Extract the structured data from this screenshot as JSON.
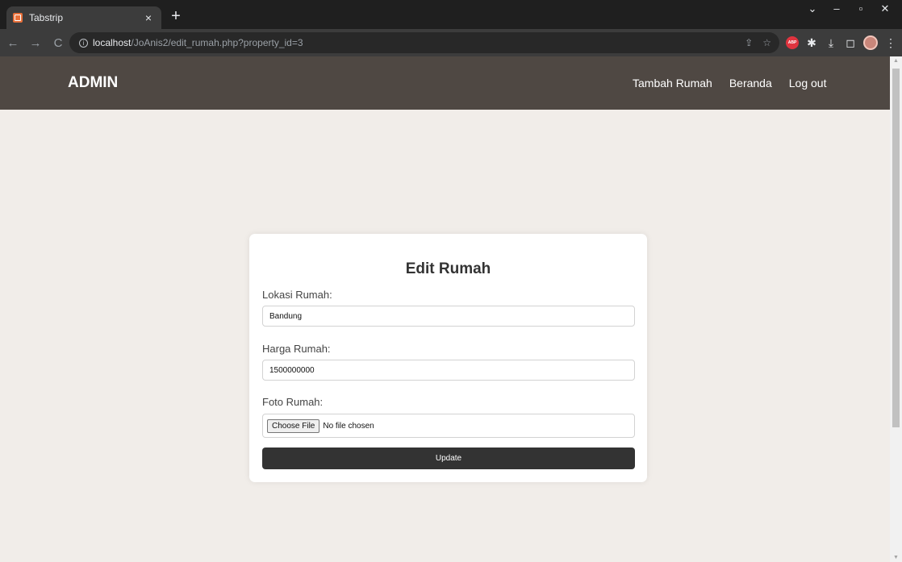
{
  "browser": {
    "tab_title": "Tabstrip",
    "tab_close": "×",
    "new_tab": "+",
    "url_host": "localhost",
    "url_path": "/JoAnis2/edit_rumah.php?property_id=3",
    "nav_back": "←",
    "nav_forward": "→",
    "nav_reload": "C",
    "info_icon": "i",
    "share_icon": "⇪",
    "star_icon": "☆",
    "abp_icon": "ABP",
    "puzzle_icon": "✱",
    "download_icon": "⤓",
    "sidepanel_icon": "◻",
    "menu_icon": "⋮",
    "win_dropdown": "⌄",
    "win_minimize": "–",
    "win_restore": "▫",
    "win_close": "✕"
  },
  "navbar": {
    "brand": "ADMIN",
    "links": [
      "Tambah Rumah",
      "Beranda",
      "Log out"
    ]
  },
  "form": {
    "title": "Edit Rumah",
    "location_label": "Lokasi Rumah:",
    "location_value": "Bandung",
    "price_label": "Harga Rumah:",
    "price_value": "1500000000",
    "photo_label": "Foto Rumah:",
    "file_button": "Choose File",
    "file_status": "No file chosen",
    "submit_label": "Update"
  },
  "colors": {
    "navbar_bg": "#4f4843",
    "page_bg": "#f1ede9",
    "button_bg": "#333333"
  }
}
